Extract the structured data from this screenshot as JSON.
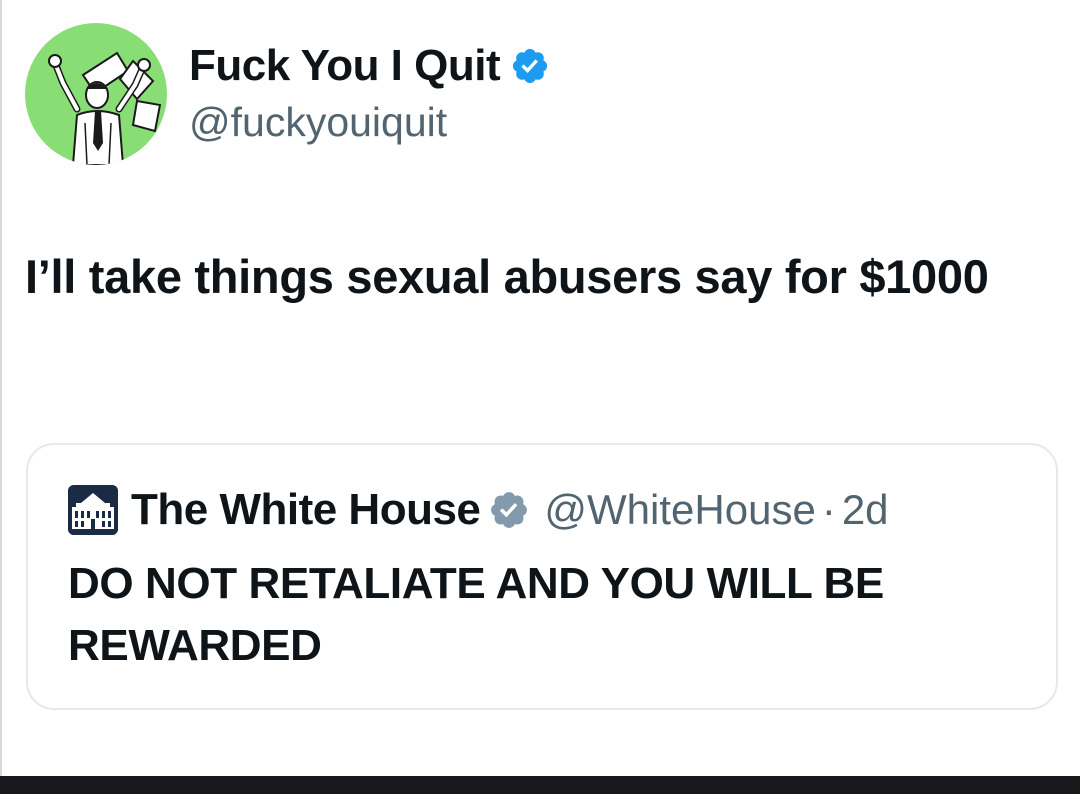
{
  "tweet": {
    "author": {
      "display_name": "Fuck You I Quit",
      "handle": "@fuckyouiquit",
      "verified": true,
      "avatar_icon": "man-throwing-papers-avatar"
    },
    "text": "I’ll take things sexual abusers say for $1000"
  },
  "quoted_tweet": {
    "author": {
      "display_name": "The White House",
      "handle": "@WhiteHouse",
      "verified": true,
      "avatar_icon": "white-house-building-avatar"
    },
    "separator": "·",
    "time": "2d",
    "text": "DO NOT RETALIATE AND YOU WILL BE REWARDED"
  },
  "colors": {
    "verified_blue": "#1d9bf0",
    "verified_gray": "#829aab",
    "avatar_green": "#88dd75",
    "secondary_text": "#536471"
  }
}
